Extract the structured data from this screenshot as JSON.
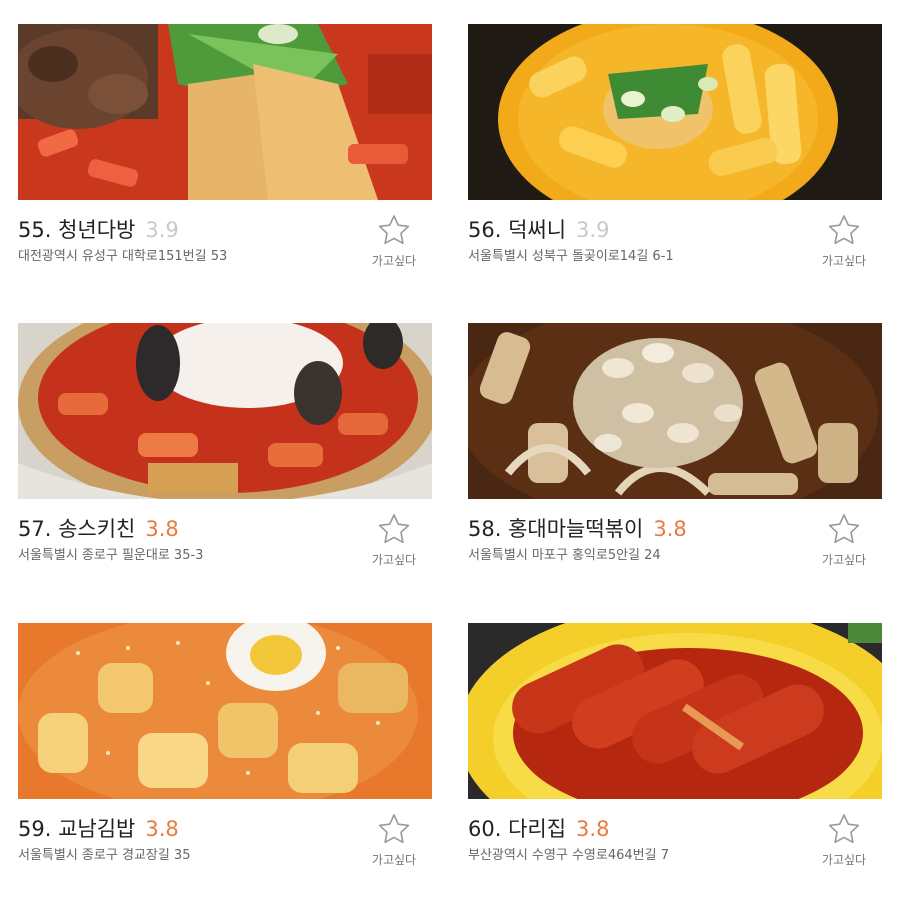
{
  "restaurants": [
    {
      "title": "55. 청년다방",
      "rating": "3.9",
      "address": "대전광역시 유성구 대학로151번길 53",
      "wish_label": "가고싶다",
      "rating_color": "#c9c9c9"
    },
    {
      "title": "56. 덕써니",
      "rating": "3.9",
      "address": "서울특별시 성북구 돌곶이로14길 6-1",
      "wish_label": "가고싶다",
      "rating_color": "#c9c9c9"
    },
    {
      "title": "57. 송스키친",
      "rating": "3.8",
      "address": "서울특별시 종로구 필운대로 35-3",
      "wish_label": "가고싶다",
      "rating_color": "#ea7a3a"
    },
    {
      "title": "58. 홍대마늘떡볶이",
      "rating": "3.8",
      "address": "서울특별시 마포구 홍익로5안길 24",
      "wish_label": "가고싶다",
      "rating_color": "#ea7a3a"
    },
    {
      "title": "59. 교남김밥",
      "rating": "3.8",
      "address": "서울특별시 종로구 경교장길 35",
      "wish_label": "가고싶다",
      "rating_color": "#ea7a3a"
    },
    {
      "title": "60. 다리집",
      "rating": "3.8",
      "address": "부산광역시 수영구 수영로464번길 7",
      "wish_label": "가고싶다",
      "rating_color": "#ea7a3a"
    }
  ],
  "icons": {
    "wish": "star-outline-icon"
  }
}
